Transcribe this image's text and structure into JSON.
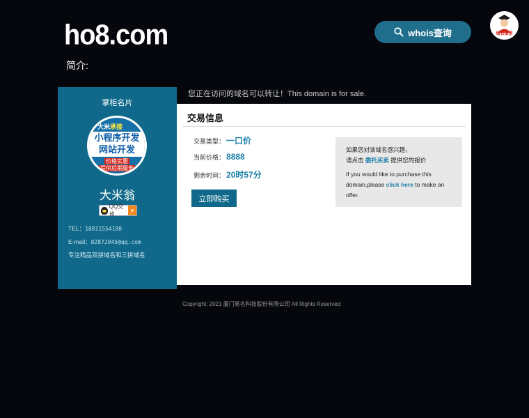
{
  "header": {
    "site_title": "ho8.com",
    "intro_label": "简介:",
    "whois_button": "whois查询",
    "mascot_text": "域名课堂"
  },
  "seller": {
    "card_title": "掌柜名片",
    "badge_top_a": "大米",
    "badge_top_b": "承接",
    "badge_line1": "小程序开发",
    "badge_line2": "网站开发",
    "badge_line3": "价格实惠",
    "badge_line4": "提供后期服务",
    "name": "大米翁",
    "qq_label": "QQ交谈",
    "tel_label": "TEL：",
    "tel_value": "18811554188",
    "email_label": "E-mail：",
    "email_value": "82872045@qq.com",
    "specialty": "专注精品双拼域名和三拼域名"
  },
  "main": {
    "sale_notice": "您正在访问的域名可以转让！This domain is for sale.",
    "panel_title": "交易信息",
    "trade_type_label": "交易类型：",
    "trade_type_value": "一口价",
    "price_label": "当前价格：",
    "price_value": "8888",
    "time_label": "剩余时间：",
    "time_value": "20时57分",
    "buy_button": "立即购买",
    "offer": {
      "line1": "如果您对该域名感兴趣，",
      "line2_pre": "请点击",
      "line2_link": "委托买卖",
      "line2_post": "提供您的报价",
      "line3": "If you would like to purchase this",
      "line4_pre": "domain,please",
      "line4_link": "click here",
      "line4_post": "to make an",
      "line5": "offer."
    }
  },
  "footer": {
    "copyright": "Copyright: 2021 厦门易名科技股份有限公司 All Rights Reserved"
  },
  "colors": {
    "background": "#05070d",
    "accent": "#10698a",
    "link": "#1a7fa8"
  }
}
